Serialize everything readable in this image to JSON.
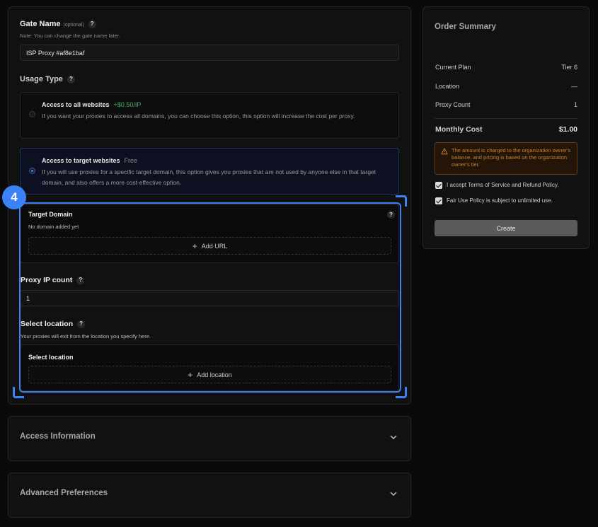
{
  "gate": {
    "label": "Gate Name",
    "optional": "(optional)",
    "note": "Note: You can change the gate name later.",
    "value": "ISP Proxy #af8e1baf"
  },
  "usage": {
    "label": "Usage Type",
    "options": [
      {
        "title": "Access to all websites",
        "tag": "+$0.50/IP",
        "desc": "If you want your proxies to access all domains, you can choose this option, this option will increase the cost per proxy.",
        "selected": false
      },
      {
        "title": "Access to target websites",
        "tag": "Free",
        "desc": "If you will use proxies for a specific target domain, this option gives you proxies that are not used by anyone else in that target domain, and also offers a more cost-effective option.",
        "selected": true
      }
    ]
  },
  "step_badge": "4",
  "target_domain": {
    "label": "Target Domain",
    "empty": "No domain added yet",
    "add_label": "Add URL"
  },
  "proxy_ip": {
    "label": "Proxy IP count",
    "value": "1"
  },
  "location": {
    "label": "Select location",
    "note": "Your proxies will exit from the location you specify here.",
    "inner_label": "Select location",
    "add_label": "Add location"
  },
  "access_info": {
    "label": "Access Information"
  },
  "advanced": {
    "label": "Advanced Preferences"
  },
  "summary": {
    "title": "Order Summary",
    "rows": [
      {
        "label": "Current Plan",
        "value": "Tier 6"
      },
      {
        "label": "Location",
        "value": "—"
      },
      {
        "label": "Proxy Count",
        "value": "1"
      }
    ],
    "monthly_label": "Monthly Cost",
    "monthly_value": "$1.00",
    "warning": "The amount is charged to the organization owner's balance, and pricing is based on the organization owner's tier.",
    "terms": "I accept Terms of Service and Refund Policy.",
    "fair_use": "Fair Use Policy is subject to unlimited use.",
    "create_label": "Create"
  },
  "colors": {
    "accent": "#3b82f6",
    "price_green": "#3fae6a",
    "warning": "#c9822e"
  }
}
